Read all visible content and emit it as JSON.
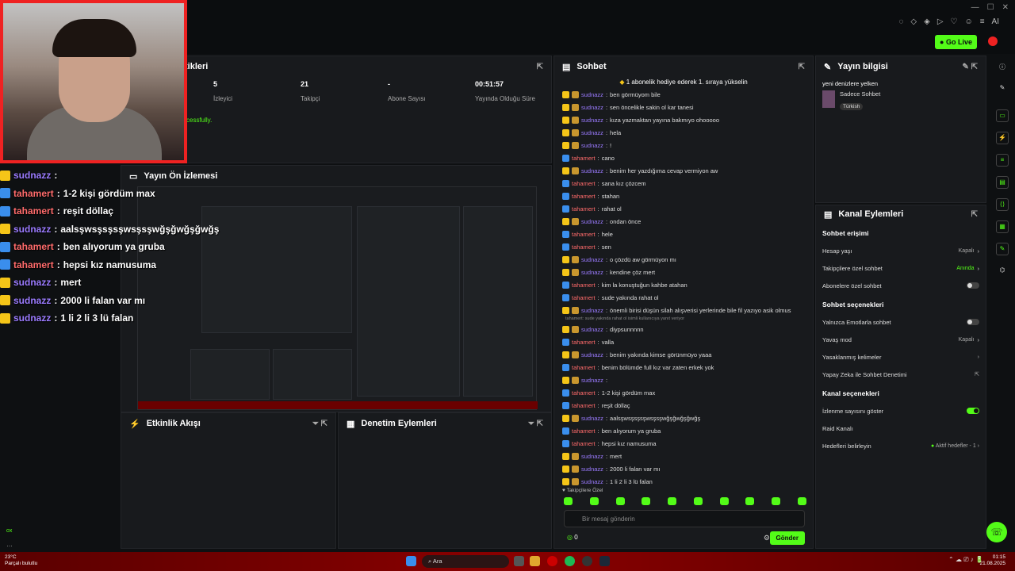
{
  "topbar": {
    "go_live": "Go Live",
    "ai_label": "AI"
  },
  "stats": {
    "title": "tikleri",
    "items": [
      {
        "value": "5",
        "label": "İzleyici"
      },
      {
        "value": "21",
        "label": "Takipçi"
      },
      {
        "value": "-",
        "label": "Abone Sayısı"
      },
      {
        "value": "00:51:57",
        "label": "Yayında Olduğu Süre"
      }
    ],
    "success_text": "cessfully."
  },
  "overlay_chat": [
    {
      "user": "sudnazz",
      "text": "",
      "color": "#9b7bff"
    },
    {
      "user": "tahamert",
      "text": "1-2 kişi gördüm max",
      "color": "#ff6b6b"
    },
    {
      "user": "tahamert",
      "text": "reşit döllaç",
      "color": "#ff6b6b"
    },
    {
      "user": "sudnazz",
      "text": "aalsşwsşsşsşwsşsşwğşğwğşğwğş",
      "color": "#9b7bff"
    },
    {
      "user": "tahamert",
      "text": "ben alıyorum ya gruba",
      "color": "#ff6b6b"
    },
    {
      "user": "tahamert",
      "text": "hepsi kız namusuma",
      "color": "#ff6b6b"
    },
    {
      "user": "sudnazz",
      "text": "mert",
      "color": "#9b7bff"
    },
    {
      "user": "sudnazz",
      "text": "2000 li falan var mı",
      "color": "#9b7bff"
    },
    {
      "user": "sudnazz",
      "text": "1 li 2 li 3 lü falan",
      "color": "#9b7bff"
    }
  ],
  "preview": {
    "title": "Yayın Ön İzlemesi"
  },
  "activity": {
    "title": "Etkinlik Akışı"
  },
  "moderation": {
    "title": "Denetim Eylemleri"
  },
  "chat": {
    "title": "Sohbet",
    "pinned": "1 abonelik hediye ederek 1. sıraya yükselin",
    "reply_note": "tahamert: sude yakında rahat ol isimli kullanıcıya yanıt veriyor",
    "messages": [
      {
        "user": "sudnazz",
        "text": "ben görmüyom bile"
      },
      {
        "user": "sudnazz",
        "text": "sen öncelikle sakin ol kar tanesi"
      },
      {
        "user": "sudnazz",
        "text": "kıza yazmaktan yayına bakmıyo ohooooo"
      },
      {
        "user": "sudnazz",
        "text": "hela"
      },
      {
        "user": "sudnazz",
        "text": "!"
      },
      {
        "user": "tahamert",
        "text": "cano"
      },
      {
        "user": "sudnazz",
        "text": "benim her yazdığıma cevap vermiyon aw"
      },
      {
        "user": "tahamert",
        "text": "sana kız çözcem"
      },
      {
        "user": "tahamert",
        "text": "stahan"
      },
      {
        "user": "tahamert",
        "text": "rahat ol"
      },
      {
        "user": "sudnazz",
        "text": "ondan önce"
      },
      {
        "user": "tahamert",
        "text": "hele"
      },
      {
        "user": "tahamert",
        "text": "sen"
      },
      {
        "user": "sudnazz",
        "text": "o çözdü aw görmüyon mı"
      },
      {
        "user": "sudnazz",
        "text": "kendine çöz mert"
      },
      {
        "user": "tahamert",
        "text": "kim la konuştuğun kahbe atahan"
      },
      {
        "user": "tahamert",
        "text": "sude yakında rahat ol"
      },
      {
        "user": "sudnazz",
        "text": "önemli birisi düşün silah alışverisi yerlerinde bile fil yazıyo asik olmus"
      },
      {
        "user": "sudnazz",
        "text": "diypsunnnnn"
      },
      {
        "user": "tahamert",
        "text": "valla"
      },
      {
        "user": "sudnazz",
        "text": "benim yakında kimse görünmüyo yaaa"
      },
      {
        "user": "tahamert",
        "text": "benim bölümde full kız var zaten erkek yok"
      },
      {
        "user": "sudnazz",
        "text": ""
      },
      {
        "user": "tahamert",
        "text": "1-2 kişi gördüm max"
      },
      {
        "user": "tahamert",
        "text": "reşit döllaç"
      },
      {
        "user": "sudnazz",
        "text": "aalsşwsşsşsşwsşsşwğşğwğşğwğş"
      },
      {
        "user": "tahamert",
        "text": "ben alıyorum ya gruba"
      },
      {
        "user": "tahamert",
        "text": "hepsi kız namusuma"
      },
      {
        "user": "sudnazz",
        "text": "mert"
      },
      {
        "user": "sudnazz",
        "text": "2000 li falan var mı"
      },
      {
        "user": "sudnazz",
        "text": "1 li 2 li 3 lü falan"
      }
    ],
    "followers_only": "Takipçilere Özel",
    "input_placeholder": "Bir mesaj gönderin",
    "count": "0",
    "send": "Gönder"
  },
  "stream_info": {
    "title": "Yayın bilgisi",
    "stream_title": "yeni denizlere yelken",
    "category": "Sadece Sohbet",
    "tag": "Türkish"
  },
  "channel_actions": {
    "title": "Kanal Eylemleri",
    "chat_access": "Sohbet erişimi",
    "account_age": "Hesap yaşı",
    "account_age_val": "Kapalı",
    "followers_chat": "Takipçilere özel sohbet",
    "followers_chat_val": "Anında",
    "subscribers_chat": "Abonelere özel sohbet",
    "chat_options": "Sohbet seçenekleri",
    "emotes_only": "Yalnızca Emotlarla sohbet",
    "slow_mode": "Yavaş mod",
    "slow_mode_val": "Kapalı",
    "banned_words": "Yasaklanmış kelimeler",
    "ai_moderation": "Yapay Zeka ile Sohbet Denetimi",
    "channel_options": "Kanal seçenekleri",
    "show_viewers": "İzlenme sayısını göster",
    "raid_channel": "Raid Kanalı",
    "set_goals": "Hedefleri belirleyin",
    "active_goals": "Aktif hedefler - 1"
  },
  "taskbar": {
    "weather_temp": "23°C",
    "weather_desc": "Parçalı bulutlu",
    "search": "Ara",
    "time": "01:15",
    "date": "21.08.2025"
  },
  "colors": {
    "accent": "#53fc18",
    "sudnazz": "#9b7bff",
    "tahamert": "#ff6b6b"
  }
}
